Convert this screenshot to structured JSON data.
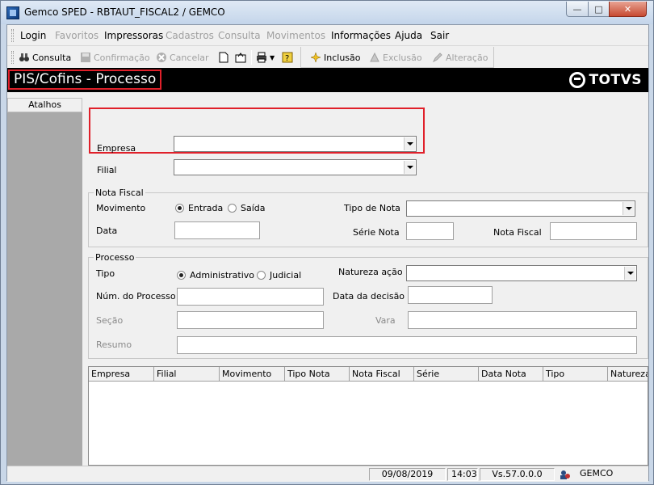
{
  "window": {
    "title": "Gemco SPED - RBTAUT_FISCAL2 / GEMCO"
  },
  "menu": {
    "items": [
      {
        "label": "Login",
        "enabled": true
      },
      {
        "label": "Favoritos",
        "enabled": false
      },
      {
        "label": "Impressoras",
        "enabled": true
      },
      {
        "label": "Cadastros",
        "enabled": false
      },
      {
        "label": "Consulta",
        "enabled": false
      },
      {
        "label": "Movimentos",
        "enabled": false
      },
      {
        "label": "Informações",
        "enabled": true
      },
      {
        "label": "Ajuda",
        "enabled": true
      },
      {
        "label": "Sair",
        "enabled": true
      }
    ]
  },
  "toolbar": {
    "consulta": "Consulta",
    "confirmacao": "Confirmação",
    "cancelar": "Cancelar",
    "inclusao": "Inclusão",
    "exclusao": "Exclusão",
    "alteracao": "Alteração"
  },
  "header": {
    "screen_title": "PIS/Cofins - Processo",
    "logo": "TOTVS"
  },
  "sidebar": {
    "tab": "Atalhos"
  },
  "filters": {
    "empresa_label": "Empresa",
    "empresa_value": "",
    "filial_label": "Filial",
    "filial_value": ""
  },
  "nota_fiscal": {
    "group_title": "Nota Fiscal",
    "movimento_label": "Movimento",
    "opt_entrada": "Entrada",
    "opt_saida": "Saída",
    "movimento_selected": "Entrada",
    "tipo_nota_label": "Tipo de Nota",
    "tipo_nota_value": "",
    "data_label": "Data",
    "data_value": "",
    "serie_nota_label": "Série Nota",
    "serie_nota_value": "",
    "nota_fiscal_label": "Nota Fiscal",
    "nota_fiscal_value": ""
  },
  "processo": {
    "group_title": "Processo",
    "tipo_label": "Tipo",
    "opt_administrativo": "Administrativo",
    "opt_judicial": "Judicial",
    "tipo_selected": "Administrativo",
    "natureza_label": "Natureza ação",
    "natureza_value": "",
    "num_processo_label": "Núm. do Processo",
    "num_processo_value": "",
    "data_decisao_label": "Data da decisão",
    "data_decisao_value": "",
    "secao_label": "Seção",
    "secao_value": "",
    "vara_label": "Vara",
    "vara_value": "",
    "resumo_label": "Resumo",
    "resumo_value": ""
  },
  "grid": {
    "columns": [
      "Empresa",
      "Filial",
      "Movimento",
      "Tipo Nota",
      "Nota Fiscal",
      "Série",
      "Data Nota",
      "Tipo",
      "Natureza"
    ],
    "rows": []
  },
  "status": {
    "date": "09/08/2019",
    "time": "14:03",
    "version": "Vs.57.0.0.0",
    "company": "GEMCO"
  }
}
